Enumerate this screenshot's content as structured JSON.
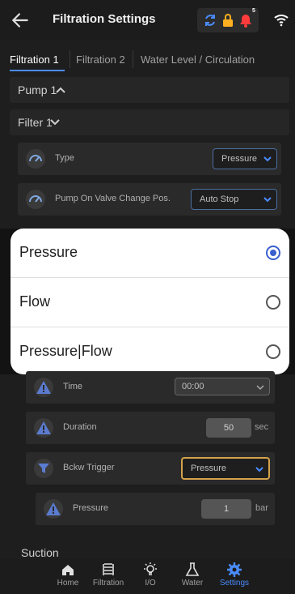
{
  "header": {
    "title": "Filtration Settings",
    "notification_count": "5"
  },
  "tabs": [
    {
      "label": "Filtration 1",
      "active": true
    },
    {
      "label": "Filtration 2",
      "active": false
    },
    {
      "label": "Water Level / Circulation",
      "active": false
    }
  ],
  "sections": {
    "pump1": "Pump 1",
    "filter1": "Filter 1",
    "suction": "Suction"
  },
  "rows": {
    "type": {
      "label": "Type",
      "value": "Pressure"
    },
    "pump_on_valve": {
      "label": "Pump On Valve Change Pos.",
      "value": "Auto Stop"
    },
    "time": {
      "label": "Time",
      "value": "00:00"
    },
    "duration": {
      "label": "Duration",
      "value": "50",
      "unit": "sec"
    },
    "bckw_trigger": {
      "label": "Bckw Trigger",
      "value": "Pressure"
    },
    "pressure": {
      "label": "Pressure",
      "value": "1",
      "unit": "bar"
    }
  },
  "dialog": {
    "options": [
      {
        "label": "Pressure",
        "selected": true
      },
      {
        "label": "Flow",
        "selected": false
      },
      {
        "label": "Pressure|Flow",
        "selected": false
      }
    ]
  },
  "bottom_nav": [
    {
      "label": "Home",
      "icon": "home-icon",
      "active": false
    },
    {
      "label": "Filtration",
      "icon": "filtration-icon",
      "active": false
    },
    {
      "label": "I/O",
      "icon": "bulb-icon",
      "active": false
    },
    {
      "label": "Water",
      "icon": "flask-icon",
      "active": false
    },
    {
      "label": "Settings",
      "icon": "gear-icon",
      "active": true
    }
  ],
  "colors": {
    "accent": "#4a8cff",
    "highlight_border": "#d4a24a",
    "alarm": "#ff3b3b",
    "lock": "#ffb020"
  }
}
